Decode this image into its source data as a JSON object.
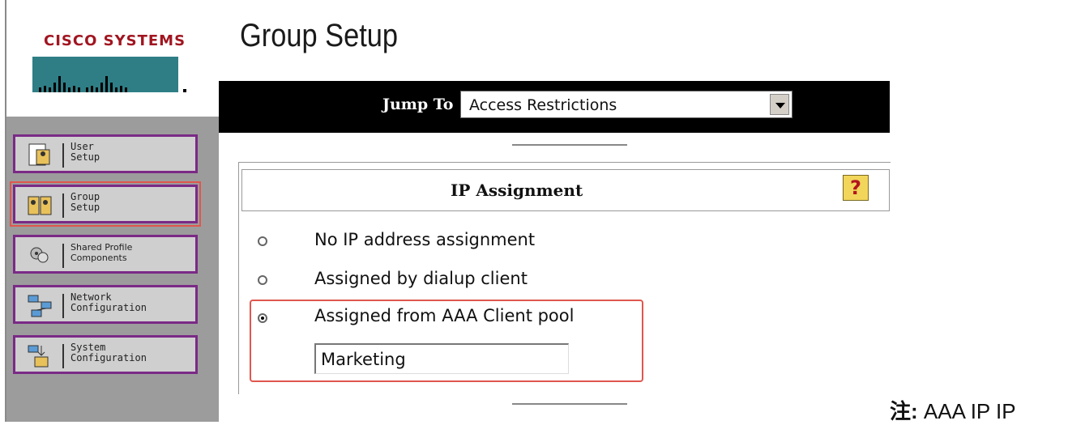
{
  "logo": {
    "text": "CISCO SYSTEMS"
  },
  "sidebar": {
    "items": [
      {
        "label": "User\nSetup",
        "icon": "user-setup-icon"
      },
      {
        "label": "Group\nSetup",
        "icon": "group-setup-icon",
        "active": true
      },
      {
        "label": "Shared Profile\nComponents",
        "icon": "shared-profile-icon"
      },
      {
        "label": "Network\nConfiguration",
        "icon": "network-config-icon"
      },
      {
        "label": "System\nConfiguration",
        "icon": "system-config-icon"
      }
    ]
  },
  "header": {
    "title": "Group Setup"
  },
  "jump": {
    "label": "Jump To",
    "selected": "Access Restrictions"
  },
  "section": {
    "title": "IP Assignment",
    "help_symbol": "?",
    "options": [
      {
        "label": "No IP address assignment",
        "selected": false
      },
      {
        "label": "Assigned by dialup client",
        "selected": false
      },
      {
        "label": "Assigned from AAA Client pool",
        "selected": true
      }
    ],
    "pool_value": "Marketing"
  },
  "note": {
    "prefix": "注:",
    "text": " AAA  IP   IP"
  },
  "colors": {
    "accent_border": "#7a2a86",
    "highlight": "#e0574f",
    "brand_red": "#a11520"
  }
}
